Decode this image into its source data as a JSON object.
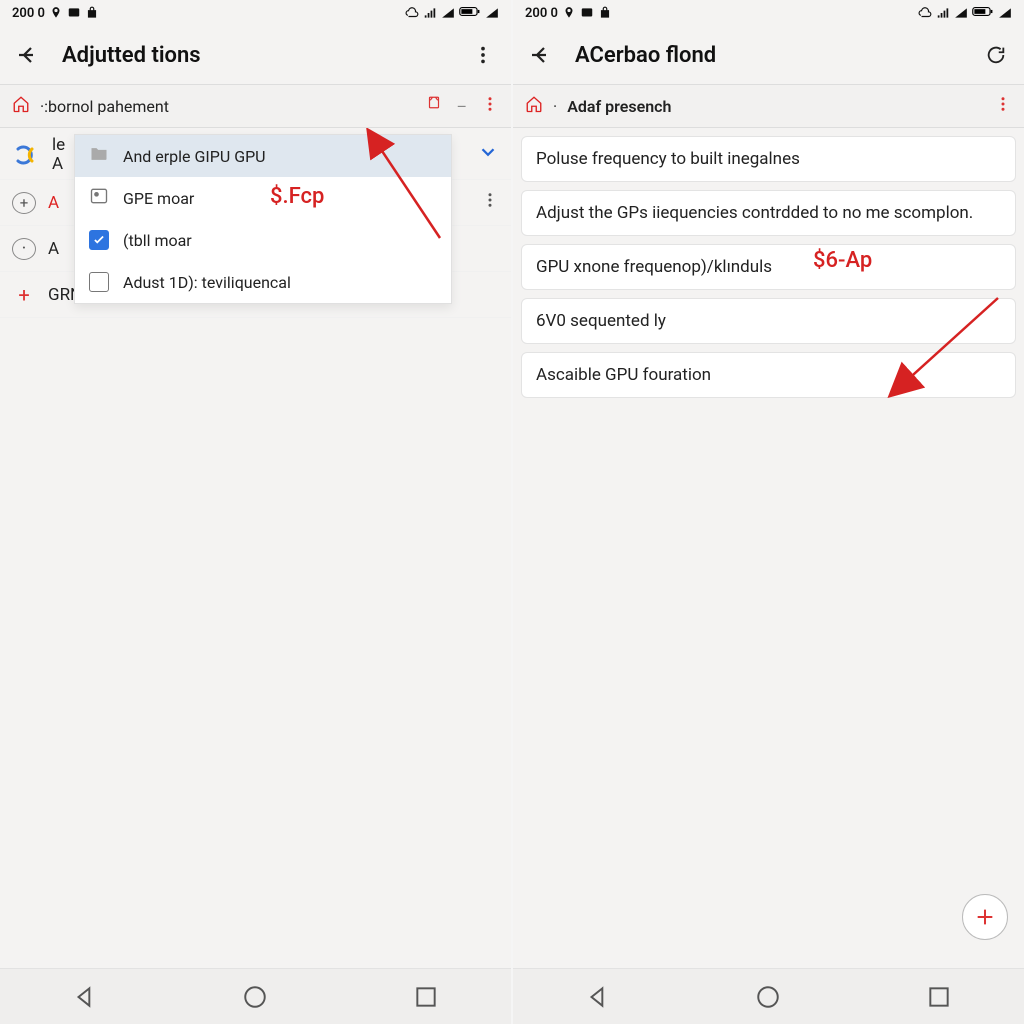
{
  "status": {
    "left_text": "200 0"
  },
  "left": {
    "app_title": "Adjutted tions",
    "section": {
      "title": "·:bornol pahement"
    },
    "rows": [
      {
        "lead": "le",
        "lead2": "A",
        "label": ""
      },
      {
        "lead": "+",
        "label": "A",
        "red": true
      },
      {
        "lead": "·",
        "label": "A"
      },
      {
        "lead": "+",
        "label": "GRN adjust fion do"
      }
    ],
    "dropdown": [
      {
        "kind": "folder",
        "label": "And erple GIPU GPU",
        "selected": true
      },
      {
        "kind": "iconbox",
        "label": "GPE moar"
      },
      {
        "kind": "checked",
        "label": "(tbll moar"
      },
      {
        "kind": "unchecked",
        "label": "Adust 1D): teviliquencal"
      }
    ],
    "annotation": "$.Fcp"
  },
  "right": {
    "app_title": "ACerbao flond",
    "section": {
      "title": "Adaf presench"
    },
    "cards": [
      "Poluse frequency to built inegalnes",
      "Adjust the GPs iiequencies contrdded to no me scomplon.",
      "GPU xnone frequenop)/klınduls",
      "6V0 sequented ly",
      "Ascaible GPU fouration"
    ],
    "annotation": "$6-Ap"
  }
}
